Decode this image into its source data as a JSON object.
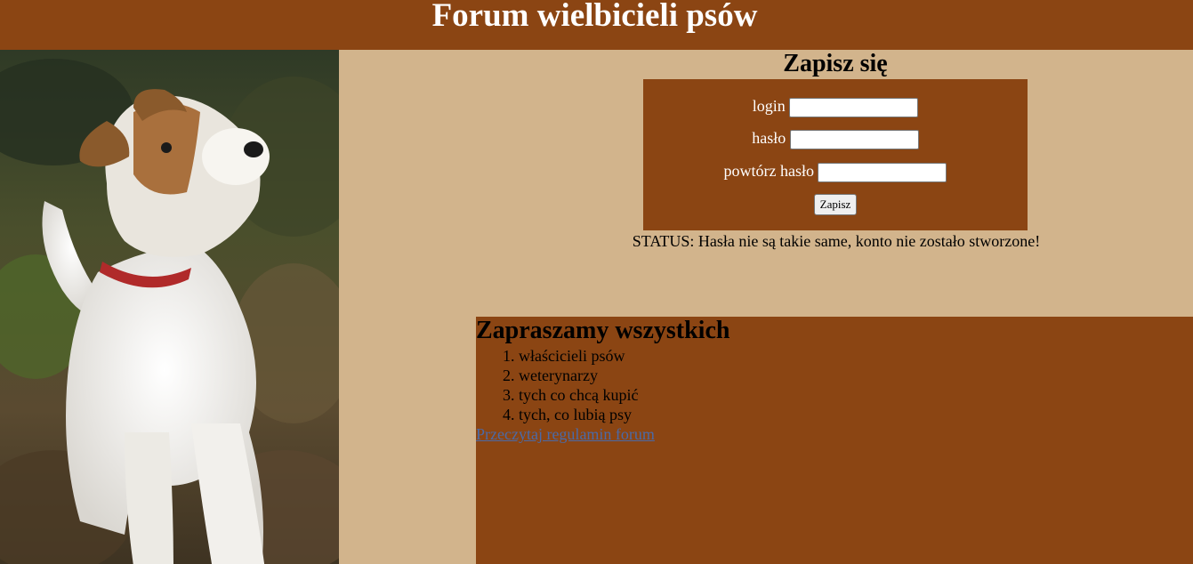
{
  "header": {
    "title": "Forum wielbicieli psów"
  },
  "signup": {
    "title": "Zapisz się",
    "login_label": "login",
    "password_label": "hasło",
    "repeat_password_label": "powtórz hasło",
    "login_value": "",
    "password_value": "",
    "repeat_password_value": "",
    "submit_label": "Zapisz",
    "status": "STATUS: Hasła nie są takie same, konto nie zostało stworzone!"
  },
  "invite": {
    "title": "Zapraszamy wszystkich",
    "items": [
      "właścicieli psów",
      "weterynarzy",
      "tych co chcą kupić",
      "tych, co lubią psy"
    ],
    "rules_link": "Przeczytaj regulamin forum"
  },
  "colors": {
    "brown": "#8b4513",
    "tan": "#d2b48c"
  },
  "photo": {
    "subject": "dog-photo"
  }
}
